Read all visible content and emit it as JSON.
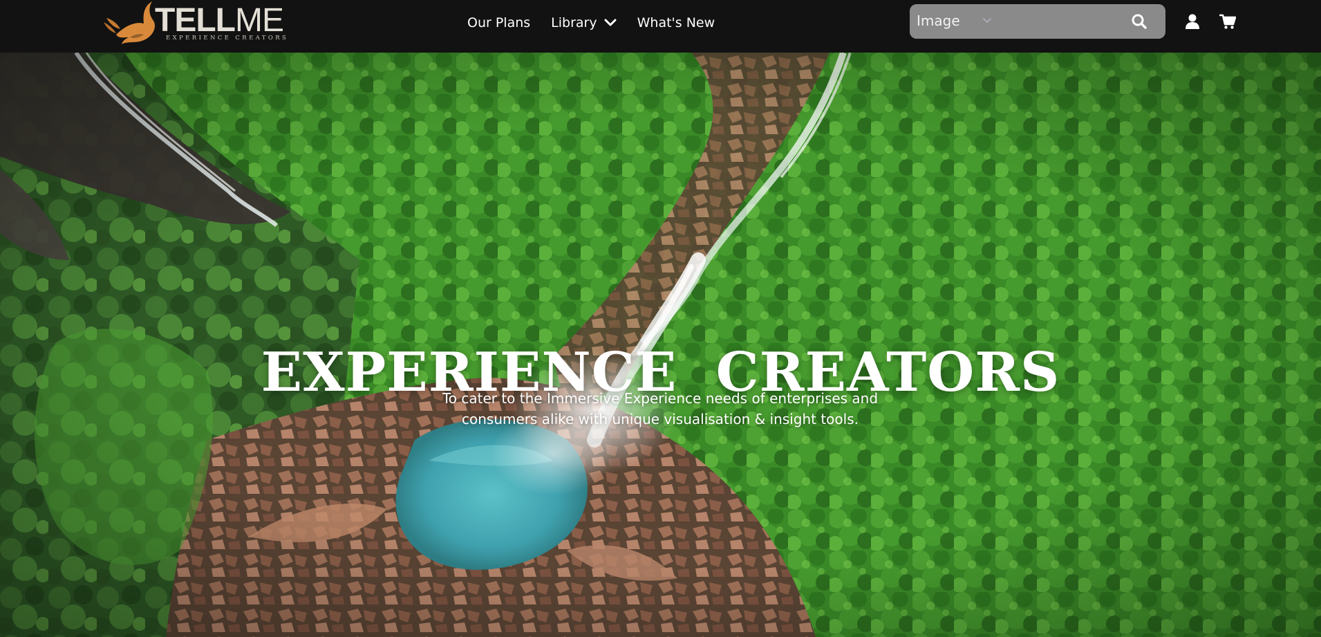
{
  "brand": {
    "name_bold": "TELL",
    "name_light": "ME",
    "tagline": "EXPERIENCE CREATORS",
    "logo_color": "#d8893a"
  },
  "nav": {
    "items": [
      {
        "label": "Our Plans"
      },
      {
        "label": "Library",
        "has_dropdown": true
      },
      {
        "label": "What's New"
      }
    ]
  },
  "search": {
    "selected_type": "Image",
    "icon": "search-icon"
  },
  "header_icons": [
    "user-icon",
    "cart-icon"
  ],
  "hero": {
    "title": "EXPERIENCE  CREATORS",
    "subtitle": "To cater to the Immersive Experience needs of enterprises and consumers alike with unique visualisation & insight tools."
  },
  "colors": {
    "navbar_bg": "#121212",
    "search_bg": "#8a8a8a",
    "accent": "#d8893a",
    "text": "#ffffff"
  }
}
